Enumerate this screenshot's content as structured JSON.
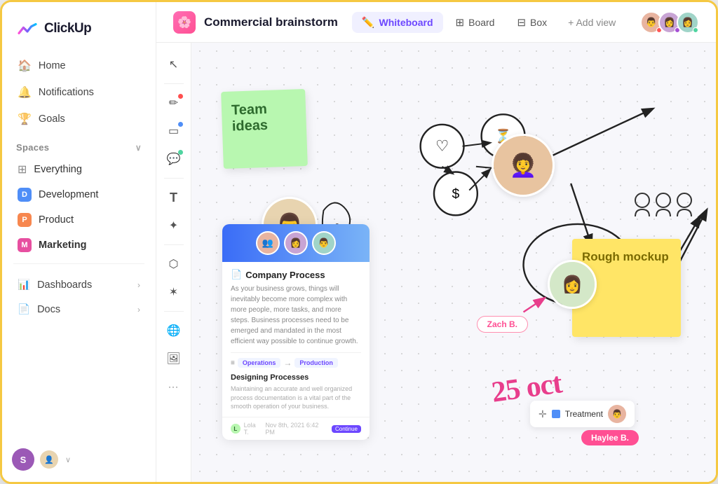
{
  "app": {
    "logo_text": "ClickUp"
  },
  "sidebar": {
    "nav_items": [
      {
        "id": "home",
        "label": "Home",
        "icon": "🏠"
      },
      {
        "id": "notifications",
        "label": "Notifications",
        "icon": "🔔"
      },
      {
        "id": "goals",
        "label": "Goals",
        "icon": "🏆"
      }
    ],
    "spaces_label": "Spaces",
    "spaces_items": [
      {
        "id": "everything",
        "label": "Everything",
        "badge": "",
        "color": ""
      },
      {
        "id": "development",
        "label": "Development",
        "badge": "D",
        "color": "#4f8ef7"
      },
      {
        "id": "product",
        "label": "Product",
        "badge": "P",
        "color": "#f7874f"
      },
      {
        "id": "marketing",
        "label": "Marketing",
        "badge": "M",
        "color": "#e74fa0"
      }
    ],
    "bottom_items": [
      {
        "id": "dashboards",
        "label": "Dashboards"
      },
      {
        "id": "docs",
        "label": "Docs"
      }
    ],
    "footer_user": "S"
  },
  "topbar": {
    "icon": "🌸",
    "title": "Commercial brainstorm",
    "tabs": [
      {
        "id": "whiteboard",
        "label": "Whiteboard",
        "icon": "✏️",
        "active": true
      },
      {
        "id": "board",
        "label": "Board",
        "icon": "⊞"
      },
      {
        "id": "box",
        "label": "Box",
        "icon": "⊟"
      }
    ],
    "add_view_label": "+ Add view",
    "avatars": [
      {
        "id": "a1",
        "color": "#e8b4a0",
        "dot": "#f55"
      },
      {
        "id": "a2",
        "color": "#c8a4d4",
        "dot": "#a64fd4"
      },
      {
        "id": "a3",
        "color": "#a0d4c8",
        "dot": "#4fd4a0"
      }
    ]
  },
  "toolbar": {
    "tools": [
      {
        "id": "cursor",
        "icon": "↖"
      },
      {
        "id": "pen",
        "icon": "✏",
        "dot": "red"
      },
      {
        "id": "shape",
        "icon": "▭",
        "dot": "blue"
      },
      {
        "id": "comment",
        "icon": "💬",
        "dot": "green"
      },
      {
        "id": "text",
        "icon": "T"
      },
      {
        "id": "sparkle",
        "icon": "✦"
      },
      {
        "id": "network",
        "icon": "⬡"
      },
      {
        "id": "star",
        "icon": "✶"
      },
      {
        "id": "globe",
        "icon": "🌐"
      },
      {
        "id": "image",
        "icon": "🖼"
      },
      {
        "id": "more",
        "icon": "···"
      }
    ]
  },
  "canvas": {
    "sticky_green": {
      "text": "Team ideas"
    },
    "sticky_yellow": {
      "text": "Rough mockup"
    },
    "doc_card": {
      "title": "Company Process",
      "desc": "As your business grows, things will inevitably become more complex with more people, more tasks, and more steps. Business processes need to be emerged and mandated in the most efficient way possible to continue growth.",
      "flow_from": "Operations",
      "flow_to": "Production",
      "section_title": "Designing Processes",
      "section_desc": "Maintaining an accurate and well organized process documentation is a vital part of the smooth operation of your business.",
      "footer_user": "Lola T.",
      "footer_date": "Nov 8th, 2021  6:42 PM",
      "footer_badge": "Continue"
    },
    "zach_tag": "Zach B.",
    "haylee_tag": "Haylee B.",
    "treatment_label": "Treatment",
    "date_text": "25 oct"
  }
}
